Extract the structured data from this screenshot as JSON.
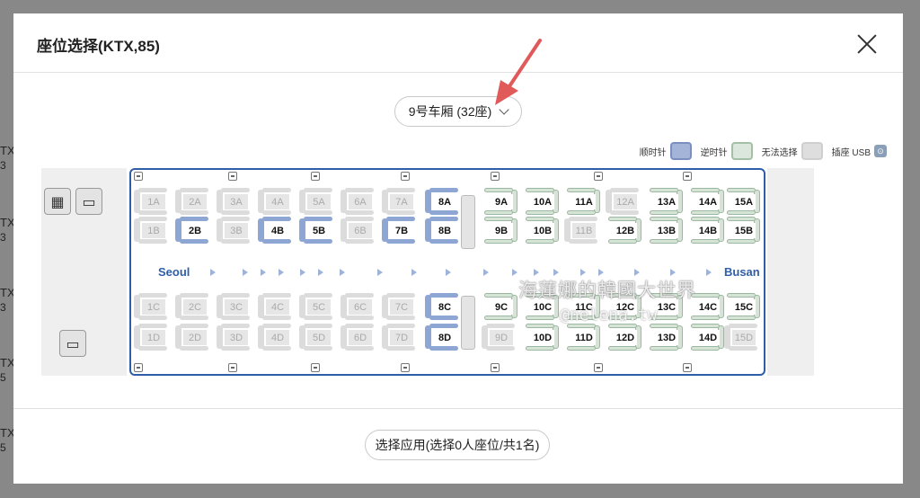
{
  "background": {
    "rows": [
      {
        "a": "TX",
        "b": "3"
      },
      {
        "a": "TX",
        "b": "3"
      },
      {
        "a": "TX",
        "b": "3"
      },
      {
        "a": "TX",
        "b": "5"
      },
      {
        "a": "TX",
        "b": "5"
      }
    ]
  },
  "modal": {
    "title": "座位选择(KTX,85)",
    "car_select": "9号车厢 (32座)",
    "apply_label": "选择应用(选择0人座位/共1名)"
  },
  "legend": {
    "clockwise": "顺时针",
    "counterclockwise": "逆时针",
    "unavailable": "无法选择",
    "usb": "插座 USB"
  },
  "map": {
    "from_city": "Seoul",
    "to_city": "Busan",
    "rows": {
      "A": [
        "1A",
        "2A",
        "3A",
        "4A",
        "5A",
        "6A",
        "7A",
        "8A",
        "9A",
        "10A",
        "11A",
        "12A",
        "13A",
        "14A",
        "15A"
      ],
      "B": [
        "1B",
        "2B",
        "3B",
        "4B",
        "5B",
        "6B",
        "7B",
        "8B",
        "9B",
        "10B",
        "11B",
        "12B",
        "13B",
        "14B",
        "15B"
      ],
      "C": [
        "1C",
        "2C",
        "3C",
        "4C",
        "5C",
        "6C",
        "7C",
        "8C",
        "9C",
        "10C",
        "11C",
        "12C",
        "13C",
        "14C",
        "15C"
      ],
      "D": [
        "1D",
        "2D",
        "3D",
        "4D",
        "5D",
        "6D",
        "7D",
        "8D",
        "9D",
        "10D",
        "11D",
        "12D",
        "13D",
        "14D",
        "15D"
      ]
    },
    "states": {
      "A": [
        "na",
        "na",
        "na",
        "na",
        "na",
        "na",
        "na",
        "cw",
        "ccw",
        "ccw",
        "ccw",
        "na",
        "ccw",
        "ccw",
        "ccw"
      ],
      "B": [
        "na",
        "cw",
        "na",
        "cw",
        "cw",
        "na",
        "cw",
        "cw",
        "ccw",
        "ccw",
        "na",
        "ccw",
        "ccw",
        "ccw",
        "ccw"
      ],
      "C": [
        "na",
        "na",
        "na",
        "na",
        "na",
        "na",
        "na",
        "cw",
        "ccw",
        "ccw",
        "ccw",
        "ccw",
        "ccw",
        "ccw",
        "ccw"
      ],
      "D": [
        "na",
        "na",
        "na",
        "na",
        "na",
        "na",
        "na",
        "cw",
        "na",
        "ccw",
        "ccw",
        "ccw",
        "ccw",
        "ccw",
        "na"
      ]
    },
    "icons": [
      "luggage-icon",
      "luggage-icon",
      "vending-icon"
    ]
  },
  "watermark": {
    "line1": "海蓮娜的韓國大世界",
    "line2": "@nelena.tw"
  }
}
